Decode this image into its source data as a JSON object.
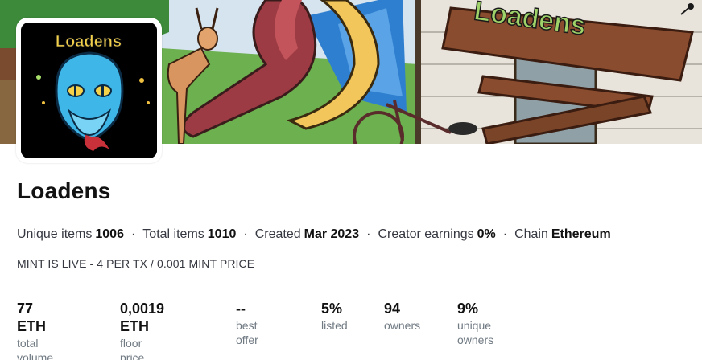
{
  "collection": {
    "name": "Loadens",
    "banner_sign_text": "Loadens",
    "avatar_text": "Loadens"
  },
  "meta": [
    {
      "label": "Unique items",
      "value": "1006"
    },
    {
      "label": "Total items",
      "value": "1010"
    },
    {
      "label": "Created",
      "value": "Mar 2023"
    },
    {
      "label": "Creator earnings",
      "value": "0%"
    },
    {
      "label": "Chain",
      "value": "Ethereum"
    }
  ],
  "meta_separator": "·",
  "description": "MINT IS LIVE - 4 PER TX / 0.001 MINT PRICE",
  "stats": [
    {
      "value": "77 ETH",
      "label": "total volume"
    },
    {
      "value": "0,0019 ETH",
      "label": "floor price"
    },
    {
      "value": "--",
      "label": "best offer"
    },
    {
      "value": "5%",
      "label": "listed"
    },
    {
      "value": "94",
      "label": "owners"
    },
    {
      "value": "9%",
      "label": "unique owners"
    }
  ],
  "colors": {
    "sky": "#d6e4ef",
    "grass": "#6cb04f",
    "slide_red": "#9c3b43",
    "slide_yellow": "#f2c65a",
    "tent_blue": "#2f7fd0",
    "wall": "#e8e4dc",
    "wood": "#8a4c2e",
    "snake_blue": "#3fb6e8"
  }
}
